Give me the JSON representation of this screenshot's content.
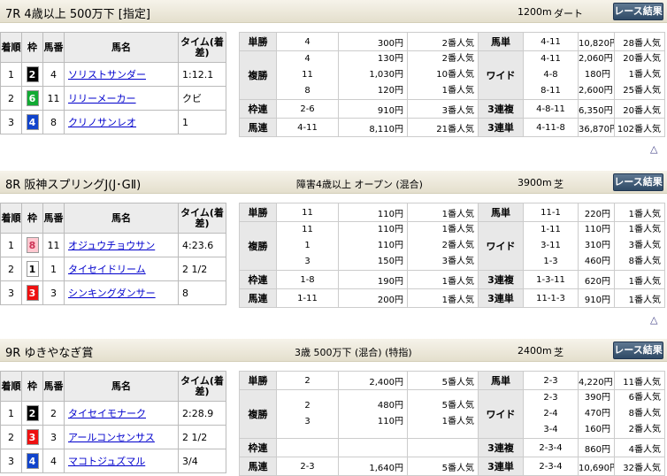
{
  "race_button_label": "レース結果",
  "up_arrow": "△",
  "headers": {
    "finish": "着順",
    "frame": "枠",
    "horse_no": "馬番",
    "horse_name": "馬名",
    "time": "タイム(着差)"
  },
  "frame_colors": {
    "1": {
      "bg": "#ffffff",
      "fg": "#000000"
    },
    "2": {
      "bg": "#000000",
      "fg": "#ffffff"
    },
    "3": {
      "bg": "#ee1111",
      "fg": "#ffffff"
    },
    "4": {
      "bg": "#1144cc",
      "fg": "#ffffff"
    },
    "6": {
      "bg": "#11aa33",
      "fg": "#ffffff"
    },
    "8": {
      "bg": "#ffc8d0",
      "fg": "#cc3355"
    }
  },
  "races": [
    {
      "name": "7R 4歳以上 500万下 [指定]",
      "condition": "",
      "distance": "1200m",
      "surface": "ダート",
      "results": [
        {
          "rank": "1",
          "frame": "2",
          "no": "4",
          "horse": "ソリストサンダー",
          "time": "1:12.1"
        },
        {
          "rank": "2",
          "frame": "6",
          "no": "11",
          "horse": "リリーメーカー",
          "time": "クビ"
        },
        {
          "rank": "3",
          "frame": "4",
          "no": "8",
          "horse": "クリノサンレオ",
          "time": "1"
        }
      ],
      "payouts": {
        "tansho": {
          "label": "単勝",
          "nums": [
            "4"
          ],
          "amounts": [
            "300円"
          ],
          "pops": [
            "2番人気"
          ]
        },
        "fukusho": {
          "label": "複勝",
          "nums": [
            "4",
            "11",
            "8"
          ],
          "amounts": [
            "130円",
            "1,030円",
            "120円"
          ],
          "pops": [
            "2番人気",
            "10番人気",
            "1番人気"
          ]
        },
        "wakuren": {
          "label": "枠連",
          "nums": [
            "2-6"
          ],
          "amounts": [
            "910円"
          ],
          "pops": [
            "3番人気"
          ]
        },
        "umaren": {
          "label": "馬連",
          "nums": [
            "4-11"
          ],
          "amounts": [
            "8,110円"
          ],
          "pops": [
            "21番人気"
          ]
        },
        "umatan": {
          "label": "馬単",
          "nums": [
            "4-11"
          ],
          "amounts": [
            "10,820円"
          ],
          "pops": [
            "28番人気"
          ]
        },
        "wide": {
          "label": "ワイド",
          "nums": [
            "4-11",
            "4-8",
            "8-11"
          ],
          "amounts": [
            "2,060円",
            "180円",
            "2,600円"
          ],
          "pops": [
            "20番人気",
            "1番人気",
            "25番人気"
          ]
        },
        "sanrenpuku": {
          "label": "3連複",
          "nums": [
            "4-8-11"
          ],
          "amounts": [
            "6,350円"
          ],
          "pops": [
            "20番人気"
          ]
        },
        "sanrentan": {
          "label": "3連単",
          "nums": [
            "4-11-8"
          ],
          "amounts": [
            "36,870円"
          ],
          "pops": [
            "102番人気"
          ]
        }
      }
    },
    {
      "name": "8R 阪神スプリングJ(J･GⅡ)",
      "condition": "障害4歳以上 オープン (混合)",
      "distance": "3900m",
      "surface": "芝",
      "results": [
        {
          "rank": "1",
          "frame": "8",
          "no": "11",
          "horse": "オジュウチョウサン",
          "time": "4:23.6"
        },
        {
          "rank": "2",
          "frame": "1",
          "no": "1",
          "horse": "タイセイドリーム",
          "time": "2 1/2"
        },
        {
          "rank": "3",
          "frame": "3",
          "no": "3",
          "horse": "シンキングダンサー",
          "time": "8"
        }
      ],
      "payouts": {
        "tansho": {
          "label": "単勝",
          "nums": [
            "11"
          ],
          "amounts": [
            "110円"
          ],
          "pops": [
            "1番人気"
          ]
        },
        "fukusho": {
          "label": "複勝",
          "nums": [
            "11",
            "1",
            "3"
          ],
          "amounts": [
            "110円",
            "110円",
            "150円"
          ],
          "pops": [
            "1番人気",
            "2番人気",
            "3番人気"
          ]
        },
        "wakuren": {
          "label": "枠連",
          "nums": [
            "1-8"
          ],
          "amounts": [
            "190円"
          ],
          "pops": [
            "1番人気"
          ]
        },
        "umaren": {
          "label": "馬連",
          "nums": [
            "1-11"
          ],
          "amounts": [
            "200円"
          ],
          "pops": [
            "1番人気"
          ]
        },
        "umatan": {
          "label": "馬単",
          "nums": [
            "11-1"
          ],
          "amounts": [
            "220円"
          ],
          "pops": [
            "1番人気"
          ]
        },
        "wide": {
          "label": "ワイド",
          "nums": [
            "1-11",
            "3-11",
            "1-3"
          ],
          "amounts": [
            "110円",
            "310円",
            "460円"
          ],
          "pops": [
            "1番人気",
            "3番人気",
            "8番人気"
          ]
        },
        "sanrenpuku": {
          "label": "3連複",
          "nums": [
            "1-3-11"
          ],
          "amounts": [
            "620円"
          ],
          "pops": [
            "1番人気"
          ]
        },
        "sanrentan": {
          "label": "3連単",
          "nums": [
            "11-1-3"
          ],
          "amounts": [
            "910円"
          ],
          "pops": [
            "1番人気"
          ]
        }
      }
    },
    {
      "name": "9R ゆきやなぎ賞",
      "condition": "3歳 500万下 (混合) (特指)",
      "distance": "2400m",
      "surface": "芝",
      "results": [
        {
          "rank": "1",
          "frame": "2",
          "no": "2",
          "horse": "タイセイモナーク",
          "time": "2:28.9"
        },
        {
          "rank": "2",
          "frame": "3",
          "no": "3",
          "horse": "アールコンセンサス",
          "time": "2 1/2"
        },
        {
          "rank": "3",
          "frame": "4",
          "no": "4",
          "horse": "マコトジュズマル",
          "time": "3/4"
        }
      ],
      "payouts": {
        "tansho": {
          "label": "単勝",
          "nums": [
            "2"
          ],
          "amounts": [
            "2,400円"
          ],
          "pops": [
            "5番人気"
          ]
        },
        "fukusho": {
          "label": "複勝",
          "nums": [
            "2",
            "3"
          ],
          "amounts": [
            "480円",
            "110円"
          ],
          "pops": [
            "5番人気",
            "1番人気"
          ]
        },
        "wakuren": {
          "label": "枠連",
          "nums": [
            ""
          ],
          "amounts": [
            ""
          ],
          "pops": [
            ""
          ]
        },
        "umaren": {
          "label": "馬連",
          "nums": [
            "2-3"
          ],
          "amounts": [
            "1,640円"
          ],
          "pops": [
            "5番人気"
          ]
        },
        "umatan": {
          "label": "馬単",
          "nums": [
            "2-3"
          ],
          "amounts": [
            "4,220円"
          ],
          "pops": [
            "11番人気"
          ]
        },
        "wide": {
          "label": "ワイド",
          "nums": [
            "2-3",
            "2-4",
            "3-4"
          ],
          "amounts": [
            "390円",
            "470円",
            "160円"
          ],
          "pops": [
            "6番人気",
            "8番人気",
            "2番人気"
          ]
        },
        "sanrenpuku": {
          "label": "3連複",
          "nums": [
            "2-3-4"
          ],
          "amounts": [
            "860円"
          ],
          "pops": [
            "4番人気"
          ]
        },
        "sanrentan": {
          "label": "3連単",
          "nums": [
            "2-3-4"
          ],
          "amounts": [
            "10,690円"
          ],
          "pops": [
            "32番人気"
          ]
        }
      }
    }
  ]
}
